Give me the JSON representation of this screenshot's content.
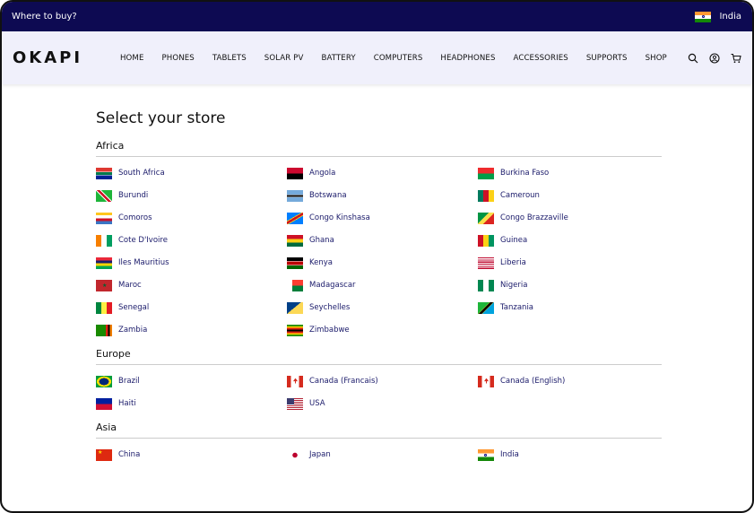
{
  "topbar": {
    "label": "Where to buy?",
    "country": "India",
    "country_flag": "in"
  },
  "brand": "OKAPI",
  "nav": [
    "HOME",
    "PHONES",
    "TABLETS",
    "SOLAR PV",
    "BATTERY",
    "COMPUTERS",
    "HEADPHONES",
    "ACCESSORIES",
    "SUPPORTS",
    "SHOP"
  ],
  "tools": [
    "search-icon",
    "user-icon",
    "cart-icon"
  ],
  "page_title": "Select your store",
  "regions": [
    {
      "name": "Africa",
      "stores": [
        {
          "label": "South Africa",
          "flag": "za"
        },
        {
          "label": "Angola",
          "flag": "ao"
        },
        {
          "label": "Burkina Faso",
          "flag": "bf"
        },
        {
          "label": "Burundi",
          "flag": "bi"
        },
        {
          "label": "Botswana",
          "flag": "bw"
        },
        {
          "label": "Cameroun",
          "flag": "cm"
        },
        {
          "label": "Comoros",
          "flag": "km"
        },
        {
          "label": "Congo Kinshasa",
          "flag": "cd"
        },
        {
          "label": "Congo Brazzaville",
          "flag": "cg"
        },
        {
          "label": "Cote D'Ivoire",
          "flag": "ci"
        },
        {
          "label": "Ghana",
          "flag": "gh"
        },
        {
          "label": "Guinea",
          "flag": "gn"
        },
        {
          "label": "Iles Mauritius",
          "flag": "mu"
        },
        {
          "label": "Kenya",
          "flag": "ke"
        },
        {
          "label": "Liberia",
          "flag": "lr"
        },
        {
          "label": "Maroc",
          "flag": "ma"
        },
        {
          "label": "Madagascar",
          "flag": "mg"
        },
        {
          "label": "Nigeria",
          "flag": "ng"
        },
        {
          "label": "Senegal",
          "flag": "sn"
        },
        {
          "label": "Seychelles",
          "flag": "sc"
        },
        {
          "label": "Tanzania",
          "flag": "tz"
        },
        {
          "label": "Zambia",
          "flag": "zm"
        },
        {
          "label": "Zimbabwe",
          "flag": "zw"
        }
      ]
    },
    {
      "name": "Europe",
      "stores": [
        {
          "label": "Brazil",
          "flag": "br"
        },
        {
          "label": "Canada (Francais)",
          "flag": "ca"
        },
        {
          "label": "Canada (English)",
          "flag": "ca"
        },
        {
          "label": "Haiti",
          "flag": "ht"
        },
        {
          "label": "USA",
          "flag": "us"
        }
      ]
    },
    {
      "name": "Asia",
      "stores": [
        {
          "label": "China",
          "flag": "cn"
        },
        {
          "label": "Japan",
          "flag": "jp"
        },
        {
          "label": "India",
          "flag": "in"
        }
      ]
    }
  ]
}
